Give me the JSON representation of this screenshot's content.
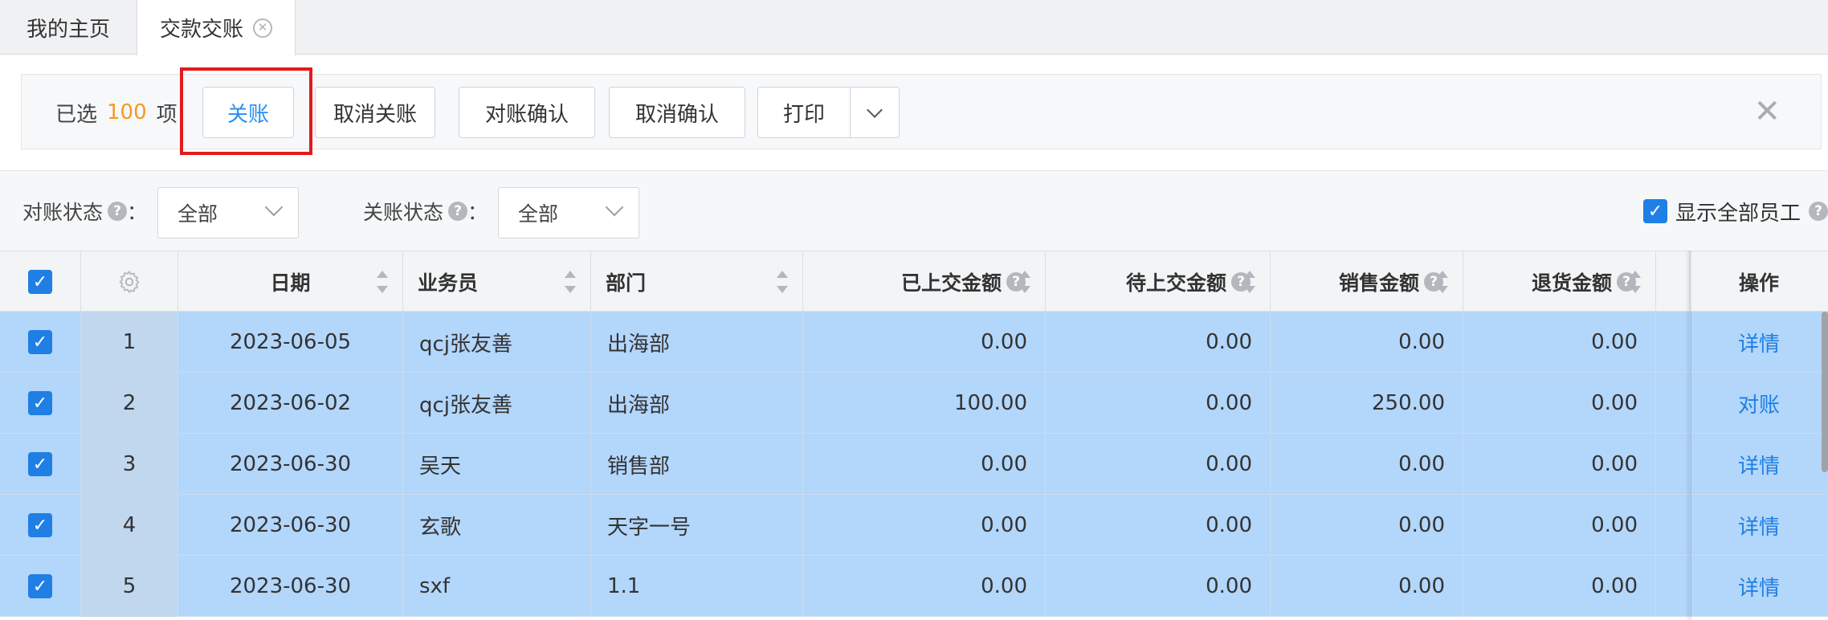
{
  "tabs": {
    "home": "我的主页",
    "active": "交款交账",
    "close_glyph": "✕"
  },
  "batch_bar": {
    "selected_prefix": "已选",
    "selected_count": "100",
    "selected_suffix": "项",
    "buttons": {
      "close_account": "关账",
      "cancel_close": "取消关账",
      "confirm_reconcile": "对账确认",
      "cancel_confirm": "取消确认",
      "print": "打印"
    },
    "close_glyph": "✕"
  },
  "filters": {
    "reconcile_status_label": "对账状态",
    "reconcile_status_value": "全部",
    "close_status_label": "关账状态",
    "close_status_value": "全部",
    "colon": "：",
    "help_glyph": "?",
    "show_all_employees": "显示全部员工",
    "show_all_checked": true
  },
  "table": {
    "columns": {
      "date": "日期",
      "salesperson": "业务员",
      "department": "部门",
      "submitted_amount": "已上交金额",
      "pending_amount": "待上交金额",
      "sales_amount": "销售金额",
      "return_amount": "退货金额",
      "actions": "操作"
    },
    "rows": [
      {
        "index": "1",
        "date": "2023-06-05",
        "salesperson": "qcj张友善",
        "department": "出海部",
        "submitted": "0.00",
        "pending": "0.00",
        "sales": "0.00",
        "returns": "0.00",
        "action": "详情"
      },
      {
        "index": "2",
        "date": "2023-06-02",
        "salesperson": "qcj张友善",
        "department": "出海部",
        "submitted": "100.00",
        "pending": "0.00",
        "sales": "250.00",
        "returns": "0.00",
        "action": "对账"
      },
      {
        "index": "3",
        "date": "2023-06-30",
        "salesperson": "吴天",
        "department": "销售部",
        "submitted": "0.00",
        "pending": "0.00",
        "sales": "0.00",
        "returns": "0.00",
        "action": "详情"
      },
      {
        "index": "4",
        "date": "2023-06-30",
        "salesperson": "玄歌",
        "department": "天字一号",
        "submitted": "0.00",
        "pending": "0.00",
        "sales": "0.00",
        "returns": "0.00",
        "action": "详情"
      },
      {
        "index": "5",
        "date": "2023-06-30",
        "salesperson": "sxf",
        "department": "1.1",
        "submitted": "0.00",
        "pending": "0.00",
        "sales": "0.00",
        "returns": "0.00",
        "action": "详情"
      }
    ]
  },
  "colors": {
    "accent": "#1f7fe5",
    "count_highlight": "#f59a23",
    "selected_row": "#b3d6fb",
    "annotation_box": "#e5191b"
  }
}
